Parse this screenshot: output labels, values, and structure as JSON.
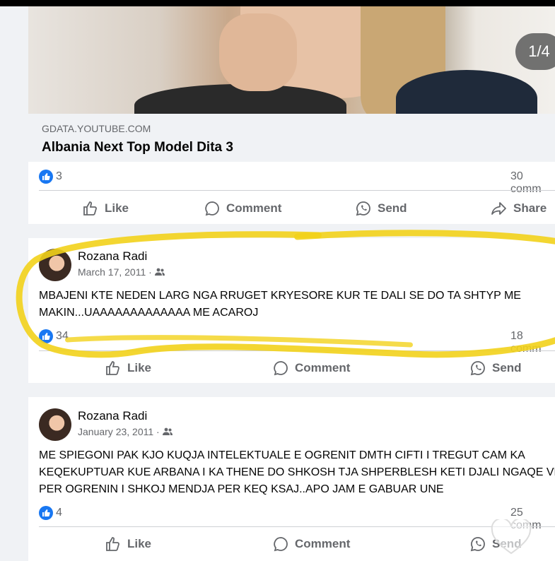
{
  "carousel": {
    "counter": "1/4"
  },
  "post1": {
    "link_domain": "GDATA.YOUTUBE.COM",
    "link_title": "Albania Next Top Model Dita 3",
    "like_count": "3",
    "comment_count": "30 comm"
  },
  "actions": {
    "like": "Like",
    "comment": "Comment",
    "send": "Send",
    "share": "Share"
  },
  "post2": {
    "author": "Rozana Radi",
    "date": "March 17, 2011 ·",
    "text_line1": "MBAJENI KTE NEDEN LARG NGA RRUGET KRYESORE KUR TE DALI SE DO TA SHTYP ME",
    "text_line2": "MAKIN...UAAAAAAAAAAAAA ME ACAROJ",
    "like_count": "34",
    "comment_count": "18 comm"
  },
  "post3": {
    "author": "Rozana Radi",
    "date": "January 23, 2011 ·",
    "text_line1": "ME SPIEGONI PAK KJO KUQJA INTELEKTUALE E OGRENIT DMTH CIFTI I TREGUT CAM KA",
    "text_line2": "KEQEKUPTUAR KUE ARBANA I KA THENE DO SHKOSH TJA SHPERBLESH KETI DJALI NGAQE VD",
    "text_line3": "PER OGRENIN I SHKOJ MENDJA PER KEQ KSAJ..APO JAM E GABUAR UNE",
    "like_count": "4",
    "comment_count": "25 comm",
    "send_label": "Send"
  },
  "colors": {
    "accent": "#1877f2",
    "highlight": "#f2d21b"
  }
}
